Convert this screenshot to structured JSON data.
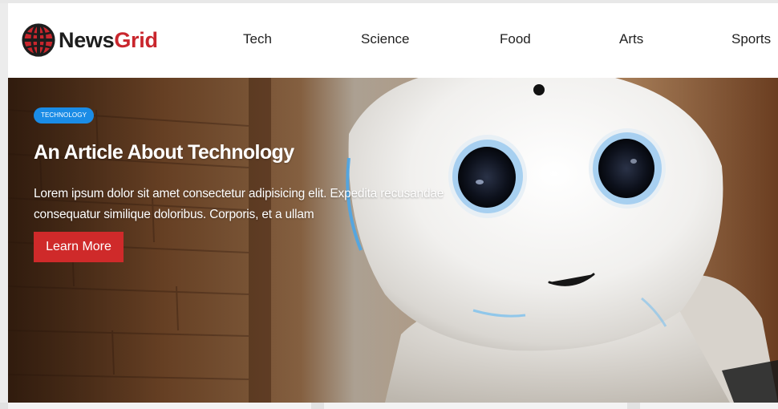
{
  "brand": {
    "name_part1": "News",
    "name_part2": "Grid",
    "icon": "globe-icon",
    "accent_color": "#c9262d"
  },
  "nav": {
    "items": [
      {
        "label": "Tech"
      },
      {
        "label": "Science"
      },
      {
        "label": "Food"
      },
      {
        "label": "Arts"
      },
      {
        "label": "Sports"
      }
    ]
  },
  "hero": {
    "category": "TECHNOLOGY",
    "title": "An Article About Technology",
    "excerpt": "Lorem ipsum dolor sit amet consectetur adipisicing elit. Expedita recusandae consequatur similique doloribus. Corporis, et a ullam",
    "cta_label": "Learn More",
    "image": "robot-photo",
    "badge_color": "#1a8ce6",
    "cta_color": "#cf2a2a"
  }
}
